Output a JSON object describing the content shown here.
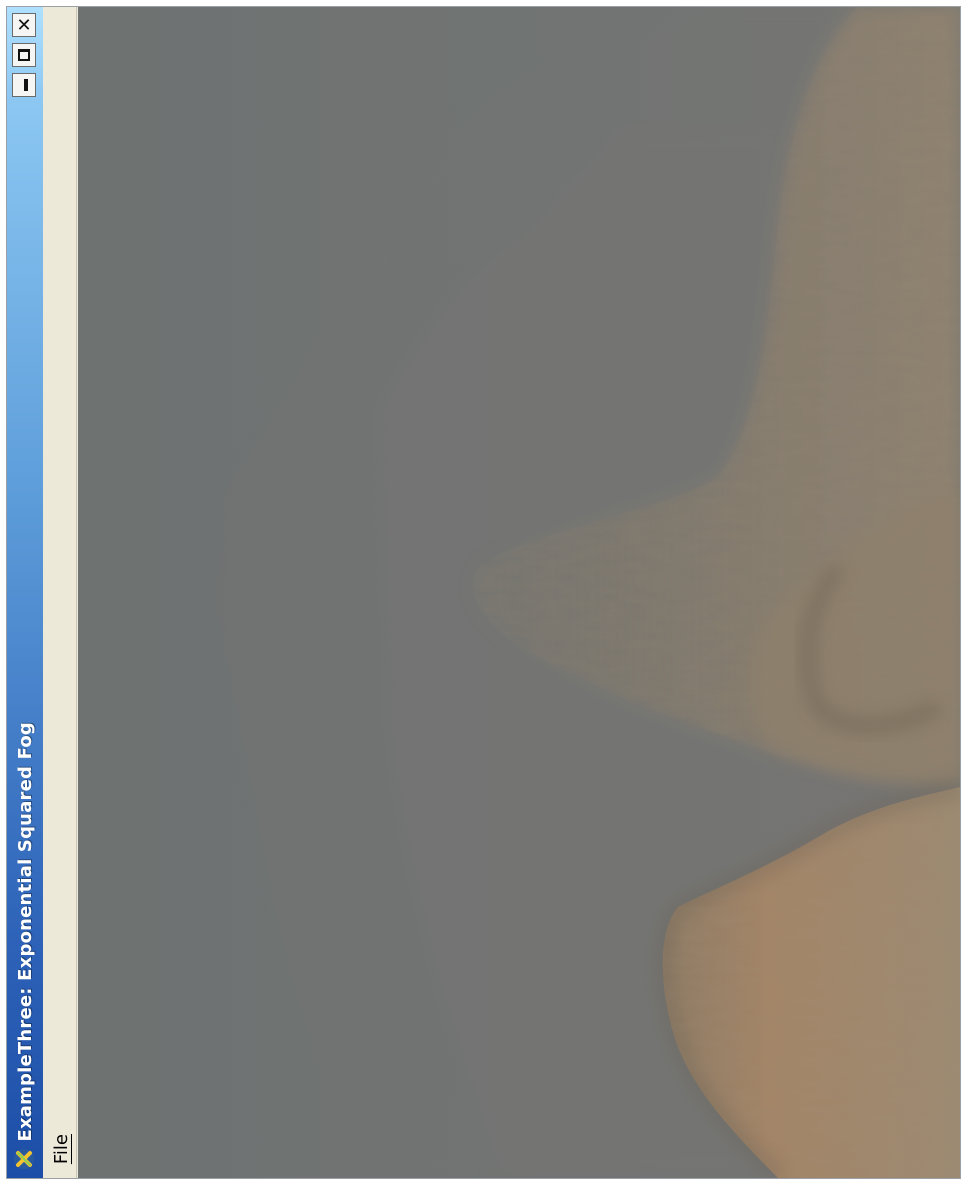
{
  "window": {
    "title": "ExampleThree: Exponential Squared Fog",
    "controls": {
      "close": "✕",
      "maximize": "maximize",
      "minimize": "minimize"
    }
  },
  "menubar": {
    "file_label": "File"
  },
  "colors": {
    "fog": "#6f7372",
    "terrain_near": "#a08468",
    "terrain_mid": "#7d7566",
    "titlebar_dark": "#1d4ea7",
    "titlebar_light": "#aee0ff"
  },
  "icons": {
    "app": "x-logo-icon",
    "close": "close-icon",
    "maximize": "maximize-icon",
    "minimize": "minimize-icon"
  }
}
